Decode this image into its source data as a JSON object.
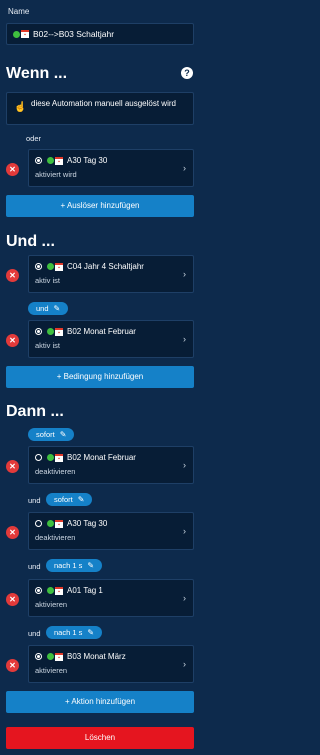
{
  "name": {
    "label": "Name",
    "value": "B02-->B03 Schaltjahr"
  },
  "wenn": {
    "title": "Wenn ...",
    "help": "?",
    "manual_text": "diese Automation manuell ausgelöst wird",
    "oder": "oder",
    "trigger": {
      "title": "A30 Tag 30",
      "subtitle": "aktiviert wird"
    },
    "add_button": "+ Auslöser hinzufügen"
  },
  "und": {
    "title": "Und ...",
    "conditions": [
      {
        "title": "C04 Jahr 4 Schaltjahr",
        "subtitle": "aktiv ist"
      },
      {
        "title": "B02 Monat Februar",
        "subtitle": "aktiv ist"
      }
    ],
    "joiner": "und",
    "add_button": "+ Bedingung hinzufügen"
  },
  "dann": {
    "title": "Dann ...",
    "first_delay": "sofort",
    "actions": [
      {
        "title": "B02 Monat Februar",
        "subtitle": "deaktivieren"
      },
      {
        "title": "A30 Tag 30",
        "subtitle": "deaktivieren"
      },
      {
        "title": "A01 Tag 1",
        "subtitle": "aktivieren"
      },
      {
        "title": "B03 Monat März",
        "subtitle": "aktivieren"
      }
    ],
    "joins": [
      {
        "word": "und",
        "delay": "sofort"
      },
      {
        "word": "und",
        "delay": "nach 1 s"
      },
      {
        "word": "und",
        "delay": "nach 1 s"
      }
    ],
    "add_button": "+ Aktion hinzufügen"
  },
  "delete_button": "Löschen",
  "icons": {
    "remove": "x-icon",
    "chevron": "chevron-right-icon",
    "pencil": "pencil-icon"
  },
  "colors": {
    "background": "#0d2a4c",
    "accent": "#1581c8",
    "danger": "#e5151f"
  }
}
